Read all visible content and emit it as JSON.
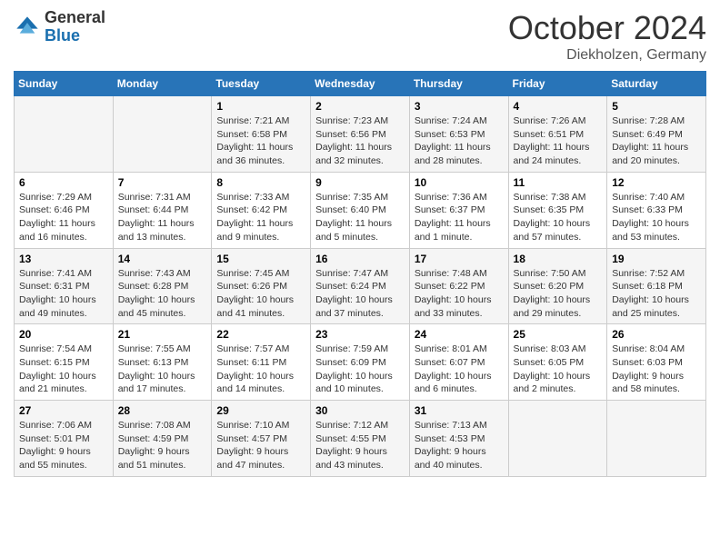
{
  "logo": {
    "general": "General",
    "blue": "Blue"
  },
  "title": {
    "month": "October 2024",
    "location": "Diekholzen, Germany"
  },
  "weekdays": [
    "Sunday",
    "Monday",
    "Tuesday",
    "Wednesday",
    "Thursday",
    "Friday",
    "Saturday"
  ],
  "weeks": [
    [
      {
        "day": "",
        "info": ""
      },
      {
        "day": "",
        "info": ""
      },
      {
        "day": "1",
        "sunrise": "Sunrise: 7:21 AM",
        "sunset": "Sunset: 6:58 PM",
        "daylight": "Daylight: 11 hours and 36 minutes."
      },
      {
        "day": "2",
        "sunrise": "Sunrise: 7:23 AM",
        "sunset": "Sunset: 6:56 PM",
        "daylight": "Daylight: 11 hours and 32 minutes."
      },
      {
        "day": "3",
        "sunrise": "Sunrise: 7:24 AM",
        "sunset": "Sunset: 6:53 PM",
        "daylight": "Daylight: 11 hours and 28 minutes."
      },
      {
        "day": "4",
        "sunrise": "Sunrise: 7:26 AM",
        "sunset": "Sunset: 6:51 PM",
        "daylight": "Daylight: 11 hours and 24 minutes."
      },
      {
        "day": "5",
        "sunrise": "Sunrise: 7:28 AM",
        "sunset": "Sunset: 6:49 PM",
        "daylight": "Daylight: 11 hours and 20 minutes."
      }
    ],
    [
      {
        "day": "6",
        "sunrise": "Sunrise: 7:29 AM",
        "sunset": "Sunset: 6:46 PM",
        "daylight": "Daylight: 11 hours and 16 minutes."
      },
      {
        "day": "7",
        "sunrise": "Sunrise: 7:31 AM",
        "sunset": "Sunset: 6:44 PM",
        "daylight": "Daylight: 11 hours and 13 minutes."
      },
      {
        "day": "8",
        "sunrise": "Sunrise: 7:33 AM",
        "sunset": "Sunset: 6:42 PM",
        "daylight": "Daylight: 11 hours and 9 minutes."
      },
      {
        "day": "9",
        "sunrise": "Sunrise: 7:35 AM",
        "sunset": "Sunset: 6:40 PM",
        "daylight": "Daylight: 11 hours and 5 minutes."
      },
      {
        "day": "10",
        "sunrise": "Sunrise: 7:36 AM",
        "sunset": "Sunset: 6:37 PM",
        "daylight": "Daylight: 11 hours and 1 minute."
      },
      {
        "day": "11",
        "sunrise": "Sunrise: 7:38 AM",
        "sunset": "Sunset: 6:35 PM",
        "daylight": "Daylight: 10 hours and 57 minutes."
      },
      {
        "day": "12",
        "sunrise": "Sunrise: 7:40 AM",
        "sunset": "Sunset: 6:33 PM",
        "daylight": "Daylight: 10 hours and 53 minutes."
      }
    ],
    [
      {
        "day": "13",
        "sunrise": "Sunrise: 7:41 AM",
        "sunset": "Sunset: 6:31 PM",
        "daylight": "Daylight: 10 hours and 49 minutes."
      },
      {
        "day": "14",
        "sunrise": "Sunrise: 7:43 AM",
        "sunset": "Sunset: 6:28 PM",
        "daylight": "Daylight: 10 hours and 45 minutes."
      },
      {
        "day": "15",
        "sunrise": "Sunrise: 7:45 AM",
        "sunset": "Sunset: 6:26 PM",
        "daylight": "Daylight: 10 hours and 41 minutes."
      },
      {
        "day": "16",
        "sunrise": "Sunrise: 7:47 AM",
        "sunset": "Sunset: 6:24 PM",
        "daylight": "Daylight: 10 hours and 37 minutes."
      },
      {
        "day": "17",
        "sunrise": "Sunrise: 7:48 AM",
        "sunset": "Sunset: 6:22 PM",
        "daylight": "Daylight: 10 hours and 33 minutes."
      },
      {
        "day": "18",
        "sunrise": "Sunrise: 7:50 AM",
        "sunset": "Sunset: 6:20 PM",
        "daylight": "Daylight: 10 hours and 29 minutes."
      },
      {
        "day": "19",
        "sunrise": "Sunrise: 7:52 AM",
        "sunset": "Sunset: 6:18 PM",
        "daylight": "Daylight: 10 hours and 25 minutes."
      }
    ],
    [
      {
        "day": "20",
        "sunrise": "Sunrise: 7:54 AM",
        "sunset": "Sunset: 6:15 PM",
        "daylight": "Daylight: 10 hours and 21 minutes."
      },
      {
        "day": "21",
        "sunrise": "Sunrise: 7:55 AM",
        "sunset": "Sunset: 6:13 PM",
        "daylight": "Daylight: 10 hours and 17 minutes."
      },
      {
        "day": "22",
        "sunrise": "Sunrise: 7:57 AM",
        "sunset": "Sunset: 6:11 PM",
        "daylight": "Daylight: 10 hours and 14 minutes."
      },
      {
        "day": "23",
        "sunrise": "Sunrise: 7:59 AM",
        "sunset": "Sunset: 6:09 PM",
        "daylight": "Daylight: 10 hours and 10 minutes."
      },
      {
        "day": "24",
        "sunrise": "Sunrise: 8:01 AM",
        "sunset": "Sunset: 6:07 PM",
        "daylight": "Daylight: 10 hours and 6 minutes."
      },
      {
        "day": "25",
        "sunrise": "Sunrise: 8:03 AM",
        "sunset": "Sunset: 6:05 PM",
        "daylight": "Daylight: 10 hours and 2 minutes."
      },
      {
        "day": "26",
        "sunrise": "Sunrise: 8:04 AM",
        "sunset": "Sunset: 6:03 PM",
        "daylight": "Daylight: 9 hours and 58 minutes."
      }
    ],
    [
      {
        "day": "27",
        "sunrise": "Sunrise: 7:06 AM",
        "sunset": "Sunset: 5:01 PM",
        "daylight": "Daylight: 9 hours and 55 minutes."
      },
      {
        "day": "28",
        "sunrise": "Sunrise: 7:08 AM",
        "sunset": "Sunset: 4:59 PM",
        "daylight": "Daylight: 9 hours and 51 minutes."
      },
      {
        "day": "29",
        "sunrise": "Sunrise: 7:10 AM",
        "sunset": "Sunset: 4:57 PM",
        "daylight": "Daylight: 9 hours and 47 minutes."
      },
      {
        "day": "30",
        "sunrise": "Sunrise: 7:12 AM",
        "sunset": "Sunset: 4:55 PM",
        "daylight": "Daylight: 9 hours and 43 minutes."
      },
      {
        "day": "31",
        "sunrise": "Sunrise: 7:13 AM",
        "sunset": "Sunset: 4:53 PM",
        "daylight": "Daylight: 9 hours and 40 minutes."
      },
      {
        "day": "",
        "info": ""
      },
      {
        "day": "",
        "info": ""
      }
    ]
  ]
}
